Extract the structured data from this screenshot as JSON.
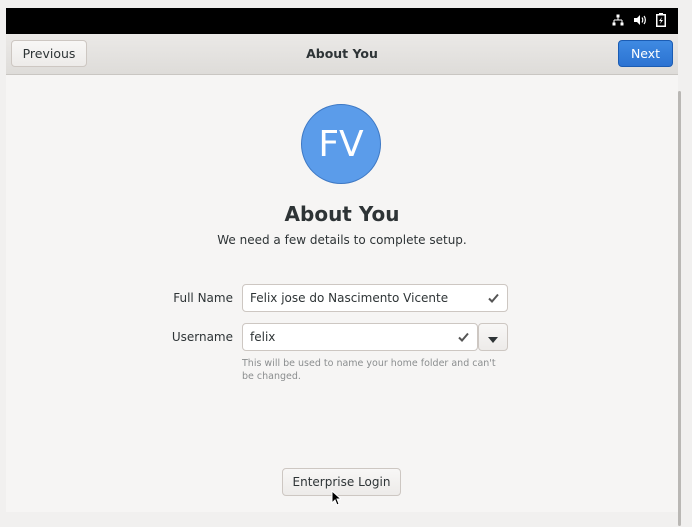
{
  "tray": {
    "icons": [
      "network-wired-icon",
      "audio-volume-icon",
      "battery-charging-icon"
    ]
  },
  "header": {
    "previous_label": "Previous",
    "title": "About You",
    "next_label": "Next"
  },
  "avatar": {
    "initials": "FV",
    "color": "#5b9cea"
  },
  "page": {
    "heading": "About You",
    "subheading": "We need a few details to complete setup."
  },
  "form": {
    "full_name_label": "Full Name",
    "full_name_value": "Felix jose do Nascimento Vicente",
    "username_label": "Username",
    "username_value": "felix",
    "hint": "This will be used to name your home folder and can't be changed."
  },
  "enterprise_login_label": "Enterprise Login",
  "colors": {
    "accent": "#3584e4",
    "topbar": "#000000"
  }
}
